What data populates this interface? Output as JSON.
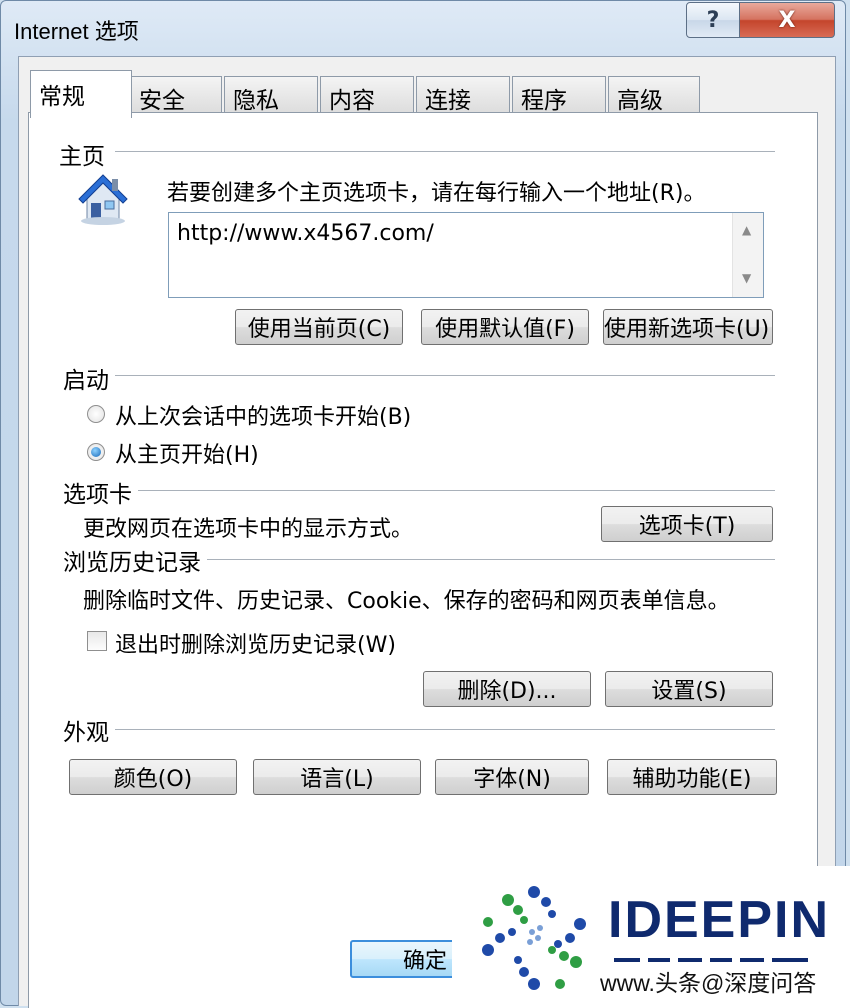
{
  "window": {
    "title": "Internet 选项",
    "help_label": "?",
    "close_label": "X"
  },
  "tabs": [
    {
      "label": "常规",
      "active": true
    },
    {
      "label": "安全"
    },
    {
      "label": "隐私"
    },
    {
      "label": "内容"
    },
    {
      "label": "连接"
    },
    {
      "label": "程序"
    },
    {
      "label": "高级"
    }
  ],
  "home": {
    "heading": "主页",
    "instruction": "若要创建多个主页选项卡，请在每行输入一个地址(R)。",
    "address": "http://www.x4567.com/",
    "icon": "house-icon",
    "buttons": {
      "use_current": "使用当前页(C)",
      "use_default": "使用默认值(F)",
      "use_new_tab": "使用新选项卡(U)"
    }
  },
  "startup": {
    "heading": "启动",
    "opt_last_session": "从上次会话中的选项卡开始(B)",
    "opt_home": "从主页开始(H)",
    "selected": "opt_home"
  },
  "tabs_group": {
    "heading": "选项卡",
    "description": "更改网页在选项卡中的显示方式。",
    "button": "选项卡(T)"
  },
  "history": {
    "heading": "浏览历史记录",
    "description": "删除临时文件、历史记录、Cookie、保存的密码和网页表单信息。",
    "checkbox_label": "退出时删除浏览历史记录(W)",
    "checkbox_checked": false,
    "delete_button": "删除(D)...",
    "settings_button": "设置(S)"
  },
  "appearance": {
    "heading": "外观",
    "colors_button": "颜色(O)",
    "languages_button": "语言(L)",
    "fonts_button": "字体(N)",
    "accessibility_button": "辅助功能(E)"
  },
  "footer": {
    "ok_button": "确定"
  },
  "watermark": {
    "brand": "IDEEPIN",
    "url": "www.头条@深度问答"
  }
}
